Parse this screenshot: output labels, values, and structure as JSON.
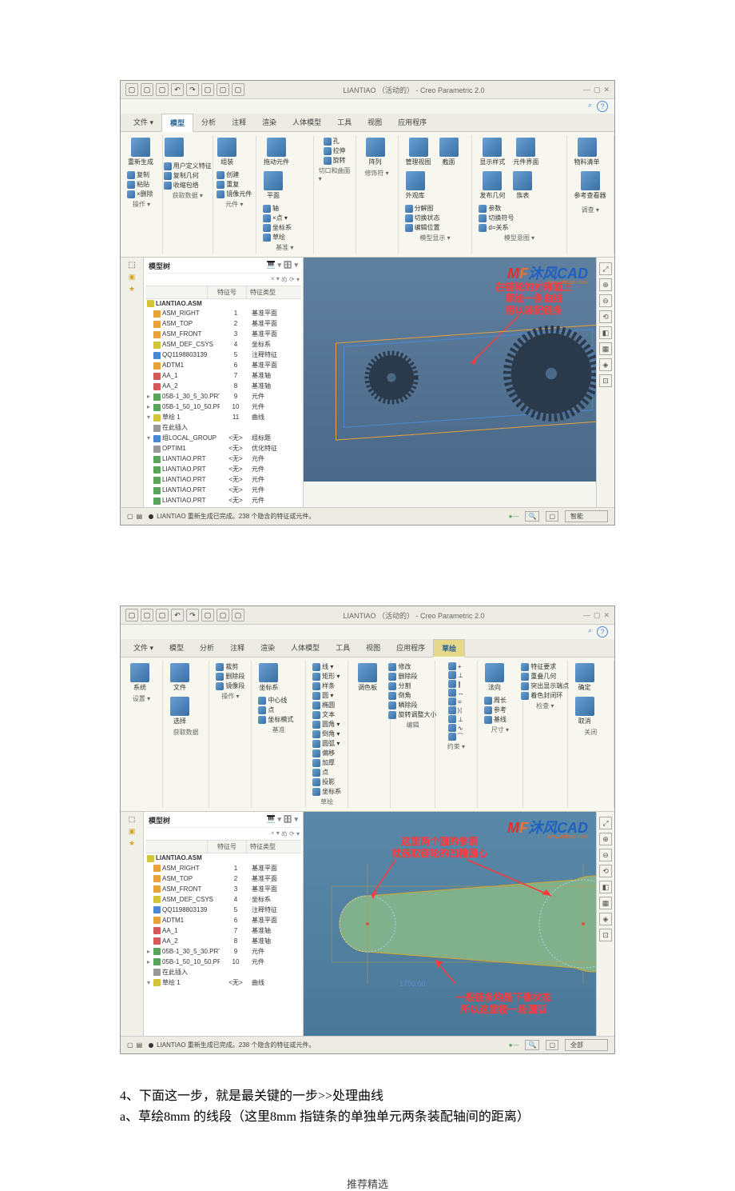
{
  "app": {
    "title": "LIANTIAO （活动的） - Creo Parametric 2.0",
    "qat_icons": [
      "new",
      "open",
      "save",
      "undo",
      "redo",
      "regen",
      "close",
      "win"
    ]
  },
  "tabs1": [
    "文件 ▾",
    "模型",
    "分析",
    "注释",
    "渲染",
    "人体模型",
    "工具",
    "视图",
    "应用程序"
  ],
  "tabs2": [
    "文件 ▾",
    "模型",
    "分析",
    "注释",
    "渲染",
    "人体模型",
    "工具",
    "视图",
    "应用程序",
    "草绘"
  ],
  "ribbon1": {
    "groups": [
      {
        "label": "操作 ▾",
        "items": [
          "重新生成"
        ],
        "small": [
          "复制",
          "粘贴",
          "×删除"
        ]
      },
      {
        "label": "获取数据 ▾",
        "items": [
          ""
        ],
        "small": [
          "用户定义特征",
          "复制几何",
          "收缩包络"
        ]
      },
      {
        "label": "元件 ▾",
        "items": [
          "组装"
        ],
        "small": [
          "创建",
          "重复",
          "镜像元件"
        ]
      },
      {
        "label": "基准 ▾",
        "items": [
          "拖动元件",
          "平面"
        ],
        "small": [
          "轴",
          "×点 ▾",
          "坐标系",
          "草绘"
        ]
      },
      {
        "label": "切口和曲面 ▾",
        "small": [
          "孔",
          "拉伸",
          "旋转"
        ]
      },
      {
        "label": "修饰符 ▾",
        "items": [
          "阵列"
        ]
      },
      {
        "label": "模型显示 ▾",
        "items": [
          "管理视图",
          "截面",
          "外观库"
        ],
        "small": [
          "分解图",
          "切换状态",
          "编辑位置"
        ]
      },
      {
        "label": "模型意图 ▾",
        "items": [
          "显示样式",
          "元件界面",
          "发布几何",
          "族表"
        ],
        "small": [
          "参数",
          "切换符号",
          "d=关系"
        ]
      },
      {
        "label": "调查 ▾",
        "items": [
          "物料清单",
          "参考查看器"
        ]
      }
    ]
  },
  "ribbon2": {
    "groups": [
      {
        "label": "设置 ▾",
        "items": [
          "系统"
        ]
      },
      {
        "label": "获取数据",
        "items": [
          "文件",
          "选择"
        ]
      },
      {
        "label": "操作 ▾",
        "small": [
          "裁剪",
          "删除段",
          "镜像段"
        ]
      },
      {
        "label": "基准",
        "items": [
          "坐标系"
        ],
        "small": [
          "中心线",
          "点",
          "坐标模式"
        ]
      },
      {
        "label": "草绘",
        "small": [
          "线 ▾",
          "矩形 ▾",
          "样条",
          "圆 ▾",
          "椭圆",
          "文本",
          "圆角 ▾",
          "倒角 ▾",
          "圆弧 ▾",
          "偏移",
          "加厚",
          "点",
          "投影",
          "坐标系"
        ]
      },
      {
        "label": "",
        "items": [
          "调色板"
        ]
      },
      {
        "label": "编辑",
        "small": [
          "修改",
          "删除段",
          "分割",
          "倒角",
          "鳞除段",
          "旋转调整大小"
        ]
      },
      {
        "label": "约束 ▾",
        "small": [
          "+",
          "⊥",
          "∥",
          "↔",
          "=",
          "ᛞ",
          "⊥",
          "∿",
          "⁀"
        ]
      },
      {
        "label": "尺寸 ▾",
        "items": [
          "法向"
        ],
        "small": [
          "周长",
          "参考",
          "基线"
        ]
      },
      {
        "label": "检查 ▾",
        "small": [
          "特征要求",
          "重叠几何",
          "突出显示端点",
          "着色封闭环"
        ]
      },
      {
        "label": "关闭",
        "items": [
          "确定",
          "取消"
        ]
      }
    ]
  },
  "tree": {
    "label": "模型树",
    "cols": [
      "",
      "特征号",
      "特征类型"
    ],
    "root": "LIANTIAO.ASM",
    "rows1": [
      {
        "icon": "o",
        "name": "ASM_RIGHT",
        "num": "1",
        "type": "基准平面"
      },
      {
        "icon": "o",
        "name": "ASM_TOP",
        "num": "2",
        "type": "基准平面"
      },
      {
        "icon": "o",
        "name": "ASM_FRONT",
        "num": "3",
        "type": "基准平面"
      },
      {
        "icon": "y",
        "name": "ASM_DEF_CSYS",
        "num": "4",
        "type": "坐标系"
      },
      {
        "icon": "b",
        "name": "QQ1198803139",
        "num": "5",
        "type": "注释特征"
      },
      {
        "icon": "o",
        "name": "ADTM1",
        "num": "6",
        "type": "基准平面"
      },
      {
        "icon": "r",
        "name": "AA_1",
        "num": "7",
        "type": "基准轴"
      },
      {
        "icon": "r",
        "name": "AA_2",
        "num": "8",
        "type": "基准轴"
      },
      {
        "icon": "g",
        "name": "05B-1_30_5_30.PRT",
        "num": "9",
        "type": "元件",
        "exp": "▸"
      },
      {
        "icon": "g",
        "name": "05B-1_50_10_50.PRT",
        "num": "10",
        "type": "元件",
        "exp": "▸"
      },
      {
        "icon": "y",
        "name": "草绘 1",
        "num": "11",
        "type": "曲线",
        "exp": "▾"
      },
      {
        "icon": "gr",
        "name": "在此插入",
        "num": "",
        "type": ""
      },
      {
        "icon": "b",
        "name": "组LOCAL_GROUP",
        "num": "<无>",
        "type": "组标题",
        "exp": "▾"
      },
      {
        "icon": "gr",
        "name": "OPTIM1",
        "num": "<无>",
        "type": "优化特征"
      },
      {
        "icon": "g",
        "name": "LIANTIAO.PRT",
        "num": "<无>",
        "type": "元件"
      },
      {
        "icon": "g",
        "name": "LIANTIAO.PRT",
        "num": "<无>",
        "type": "元件"
      },
      {
        "icon": "g",
        "name": "LIANTIAO.PRT",
        "num": "<无>",
        "type": "元件"
      },
      {
        "icon": "g",
        "name": "LIANTIAO.PRT",
        "num": "<无>",
        "type": "元件"
      },
      {
        "icon": "g",
        "name": "LIANTIAO.PRT",
        "num": "<无>",
        "type": "元件"
      }
    ],
    "rows2": [
      {
        "icon": "o",
        "name": "ASM_RIGHT",
        "num": "1",
        "type": "基准平面"
      },
      {
        "icon": "o",
        "name": "ASM_TOP",
        "num": "2",
        "type": "基准平面"
      },
      {
        "icon": "o",
        "name": "ASM_FRONT",
        "num": "3",
        "type": "基准平面"
      },
      {
        "icon": "y",
        "name": "ASM_DEF_CSYS",
        "num": "4",
        "type": "坐标系"
      },
      {
        "icon": "b",
        "name": "QQ1198803139",
        "num": "5",
        "type": "注释特征"
      },
      {
        "icon": "o",
        "name": "ADTM1",
        "num": "6",
        "type": "基准平面"
      },
      {
        "icon": "r",
        "name": "AA_1",
        "num": "7",
        "type": "基准轴"
      },
      {
        "icon": "r",
        "name": "AA_2",
        "num": "8",
        "type": "基准轴"
      },
      {
        "icon": "g",
        "name": "05B-1_30_5_30.PRT",
        "num": "9",
        "type": "元件",
        "exp": "▸"
      },
      {
        "icon": "g",
        "name": "05B-1_50_10_50.PRT",
        "num": "10",
        "type": "元件",
        "exp": "▸"
      },
      {
        "icon": "gr",
        "name": "在此插入",
        "num": "",
        "type": ""
      },
      {
        "icon": "y",
        "name": "草绘 1",
        "num": "<无>",
        "type": "曲线",
        "exp": "▾"
      }
    ]
  },
  "annotations": {
    "a1": "在链轮的对称面上\n草绘一条曲线\n用以装配链条",
    "a2": "这里两个圆的参照\n就选取链轮的凹槽圆心",
    "a3": "一般链条均是下垂状态\n所以这里接一段圆弧",
    "dim": "1700.00"
  },
  "watermark": {
    "mf": "MF",
    "rest": "沐风CAD",
    "url": "www.mfcad.com"
  },
  "status": {
    "msg": "LIANTIAO 重新生成已完成。238 个隐含的特征或元件。",
    "filter1": "智能",
    "filter2": "全部"
  },
  "body": {
    "line1": "4、下面这一步，就是最关键的一步>>处理曲线",
    "line2": "a、草绘8mm 的线段（这里8mm 指链条的单独单元两条装配轴间的距离）"
  },
  "footer": "推荐精选"
}
